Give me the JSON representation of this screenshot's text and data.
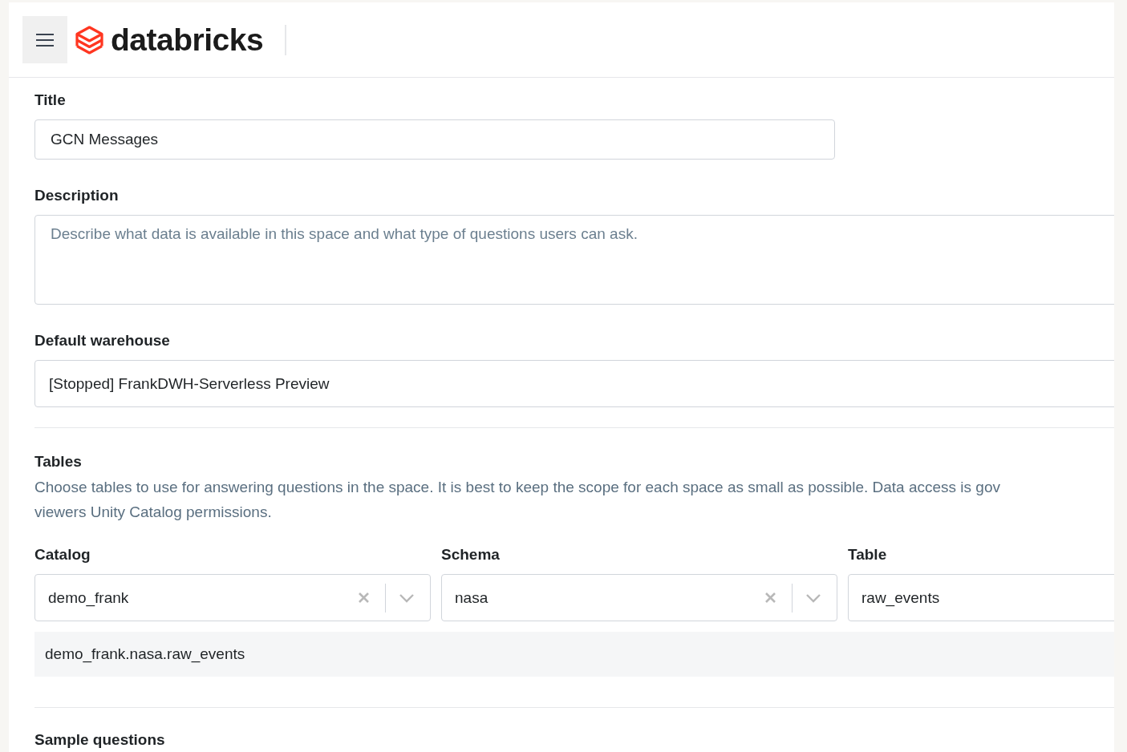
{
  "header": {
    "logo_text": "databricks"
  },
  "title_field": {
    "label": "Title",
    "value": "GCN Messages"
  },
  "description_field": {
    "label": "Description",
    "placeholder": "Describe what data is available in this space and what type of questions users can ask."
  },
  "warehouse_field": {
    "label": "Default warehouse",
    "value": "[Stopped] FrankDWH-Serverless Preview"
  },
  "tables": {
    "heading": "Tables",
    "help_lines": [
      "Choose tables to use for answering questions in the space. It is best to keep the scope for each space as small as possible. Data access is gov",
      "viewers Unity Catalog permissions."
    ],
    "pickers": [
      {
        "label": "Catalog",
        "value": "demo_frank",
        "kind": "select"
      },
      {
        "label": "Schema",
        "value": "nasa",
        "kind": "select"
      },
      {
        "label": "Table",
        "value": "raw_events",
        "kind": "plain"
      }
    ],
    "selected_tables": [
      "demo_frank.nasa.raw_events"
    ]
  },
  "sample_questions": {
    "heading": "Sample questions"
  }
}
